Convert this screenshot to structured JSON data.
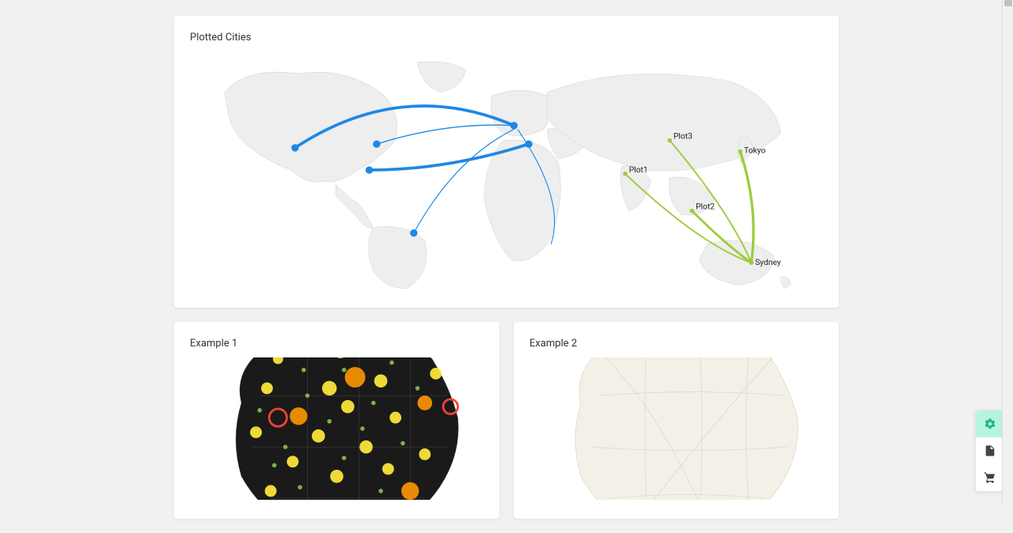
{
  "cards": {
    "plotted_cities_title": "Plotted Cities",
    "example1_title": "Example 1",
    "example2_title": "Example 2"
  },
  "chart_data": {
    "type": "map",
    "title": "Plotted Cities",
    "maps": {
      "world": {
        "series": [
          {
            "name": "blue_routes",
            "color": "#1e88e5",
            "nodes": [
              {
                "id": "US_W",
                "approx_region": "US West"
              },
              {
                "id": "US_MW",
                "approx_region": "US Midwest"
              },
              {
                "id": "US_SE",
                "approx_region": "US Southeast"
              },
              {
                "id": "S_AM",
                "approx_region": "South America"
              },
              {
                "id": "EU_W",
                "approx_region": "Western Europe"
              },
              {
                "id": "EU_SE",
                "approx_region": "Southeast Europe"
              }
            ],
            "links": [
              {
                "from": "US_W",
                "to": "EU_W",
                "weight": 3
              },
              {
                "from": "US_MW",
                "to": "EU_W",
                "weight": 1
              },
              {
                "from": "US_SE",
                "to": "EU_SE",
                "weight": 3
              },
              {
                "from": "S_AM",
                "to": "EU_W",
                "weight": 1
              },
              {
                "from": "EU_W",
                "to": "Africa_SE_coast",
                "weight": 1
              }
            ]
          },
          {
            "name": "green_routes",
            "color": "#9ccc3c",
            "nodes": [
              {
                "id": "Plot1",
                "label": "Plot1",
                "approx_region": "South Asia"
              },
              {
                "id": "Plot2",
                "label": "Plot2",
                "approx_region": "Southeast Asia"
              },
              {
                "id": "Plot3",
                "label": "Plot3",
                "approx_region": "East Asia"
              },
              {
                "id": "Tokyo",
                "label": "Tokyo",
                "approx_region": "Japan"
              },
              {
                "id": "Sydney",
                "label": "Sydney",
                "approx_region": "Australia"
              }
            ],
            "links": [
              {
                "from": "Sydney",
                "to": "Plot1",
                "weight": 2
              },
              {
                "from": "Sydney",
                "to": "Plot2",
                "weight": 3
              },
              {
                "from": "Sydney",
                "to": "Plot3",
                "weight": 2
              },
              {
                "from": "Sydney",
                "to": "Tokyo",
                "weight": 3
              }
            ]
          }
        ],
        "labels": {
          "Plot1": "Plot1",
          "Plot2": "Plot2",
          "Plot3": "Plot3",
          "Tokyo": "Tokyo",
          "Sydney": "Sydney"
        }
      },
      "example1": {
        "type": "bubble_map",
        "region": "France",
        "background": "dark",
        "description": "City population bubbles on dark France basemap; many yellow/orange/green bubbles of varying size clustered in north-center and along coasts."
      },
      "example2": {
        "type": "choropleth_map",
        "region": "France",
        "background": "light",
        "description": "Light France basemap with department borders, no data overlay visible."
      }
    }
  },
  "side_panel": {
    "actions": [
      "settings",
      "document",
      "cart"
    ]
  }
}
